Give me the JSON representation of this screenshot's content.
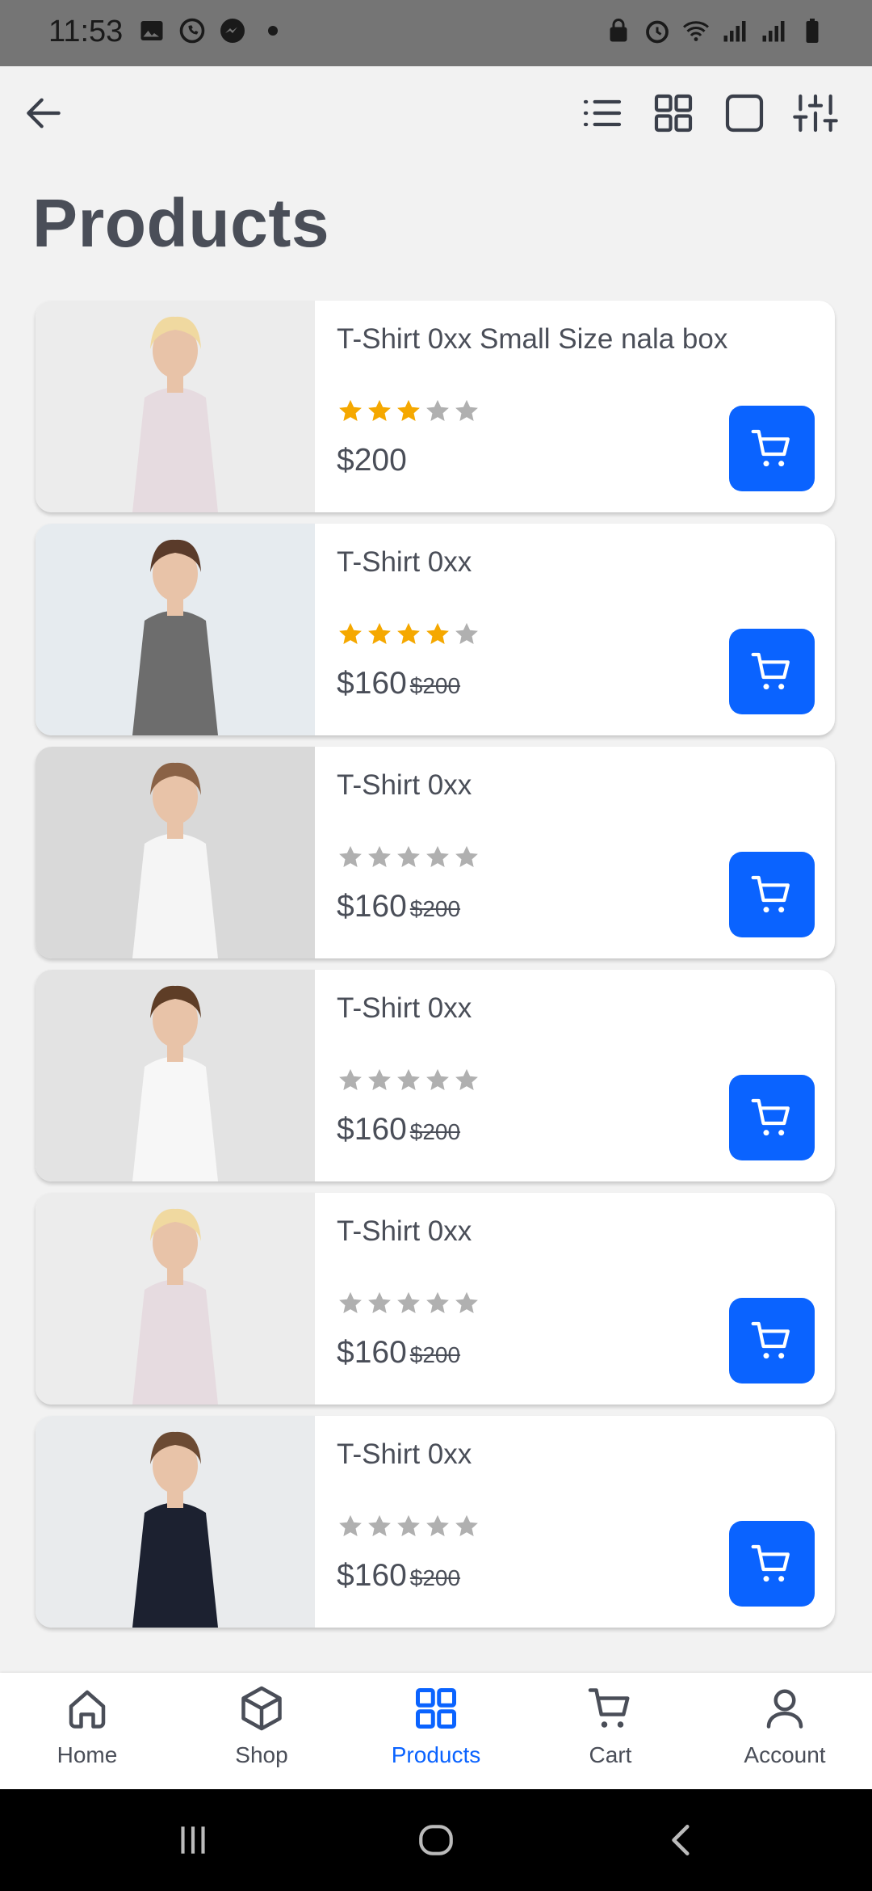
{
  "status_bar": {
    "time": "11:53",
    "left_icons": [
      "gallery-icon",
      "whatsapp-icon",
      "messenger-icon",
      "dot-icon"
    ],
    "right_icons": [
      "lock-icon",
      "alarm-icon",
      "wifi-icon",
      "signal-icon",
      "signal-icon",
      "battery-icon"
    ]
  },
  "toolbar": {
    "back_icon": "arrow-left-icon",
    "view_icons": [
      "list-view-icon",
      "grid-view-icon",
      "single-view-icon",
      "filter-sliders-icon"
    ]
  },
  "page": {
    "title": "Products"
  },
  "colors": {
    "accent": "#0a63ff",
    "star_filled": "#f5a800",
    "star_empty": "#b0b0b0",
    "background": "#f2f2f2"
  },
  "products": [
    {
      "name": "T-Shirt 0xx Small Size nala box",
      "rating": 3,
      "price": "$200",
      "old_price": ""
    },
    {
      "name": "T-Shirt 0xx",
      "rating": 4,
      "price": "$160",
      "old_price": "$200"
    },
    {
      "name": "T-Shirt 0xx",
      "rating": 0,
      "price": "$160",
      "old_price": "$200"
    },
    {
      "name": "T-Shirt 0xx",
      "rating": 0,
      "price": "$160",
      "old_price": "$200"
    },
    {
      "name": "T-Shirt 0xx",
      "rating": 0,
      "price": "$160",
      "old_price": "$200"
    },
    {
      "name": "T-Shirt 0xx",
      "rating": 0,
      "price": "$160",
      "old_price": "$200"
    }
  ],
  "bottom_nav": {
    "items": [
      {
        "label": "Home",
        "icon": "home-icon",
        "active": false
      },
      {
        "label": "Shop",
        "icon": "box-icon",
        "active": false
      },
      {
        "label": "Products",
        "icon": "grid-icon",
        "active": true
      },
      {
        "label": "Cart",
        "icon": "cart-icon",
        "active": false
      },
      {
        "label": "Account",
        "icon": "user-icon",
        "active": false
      }
    ]
  }
}
